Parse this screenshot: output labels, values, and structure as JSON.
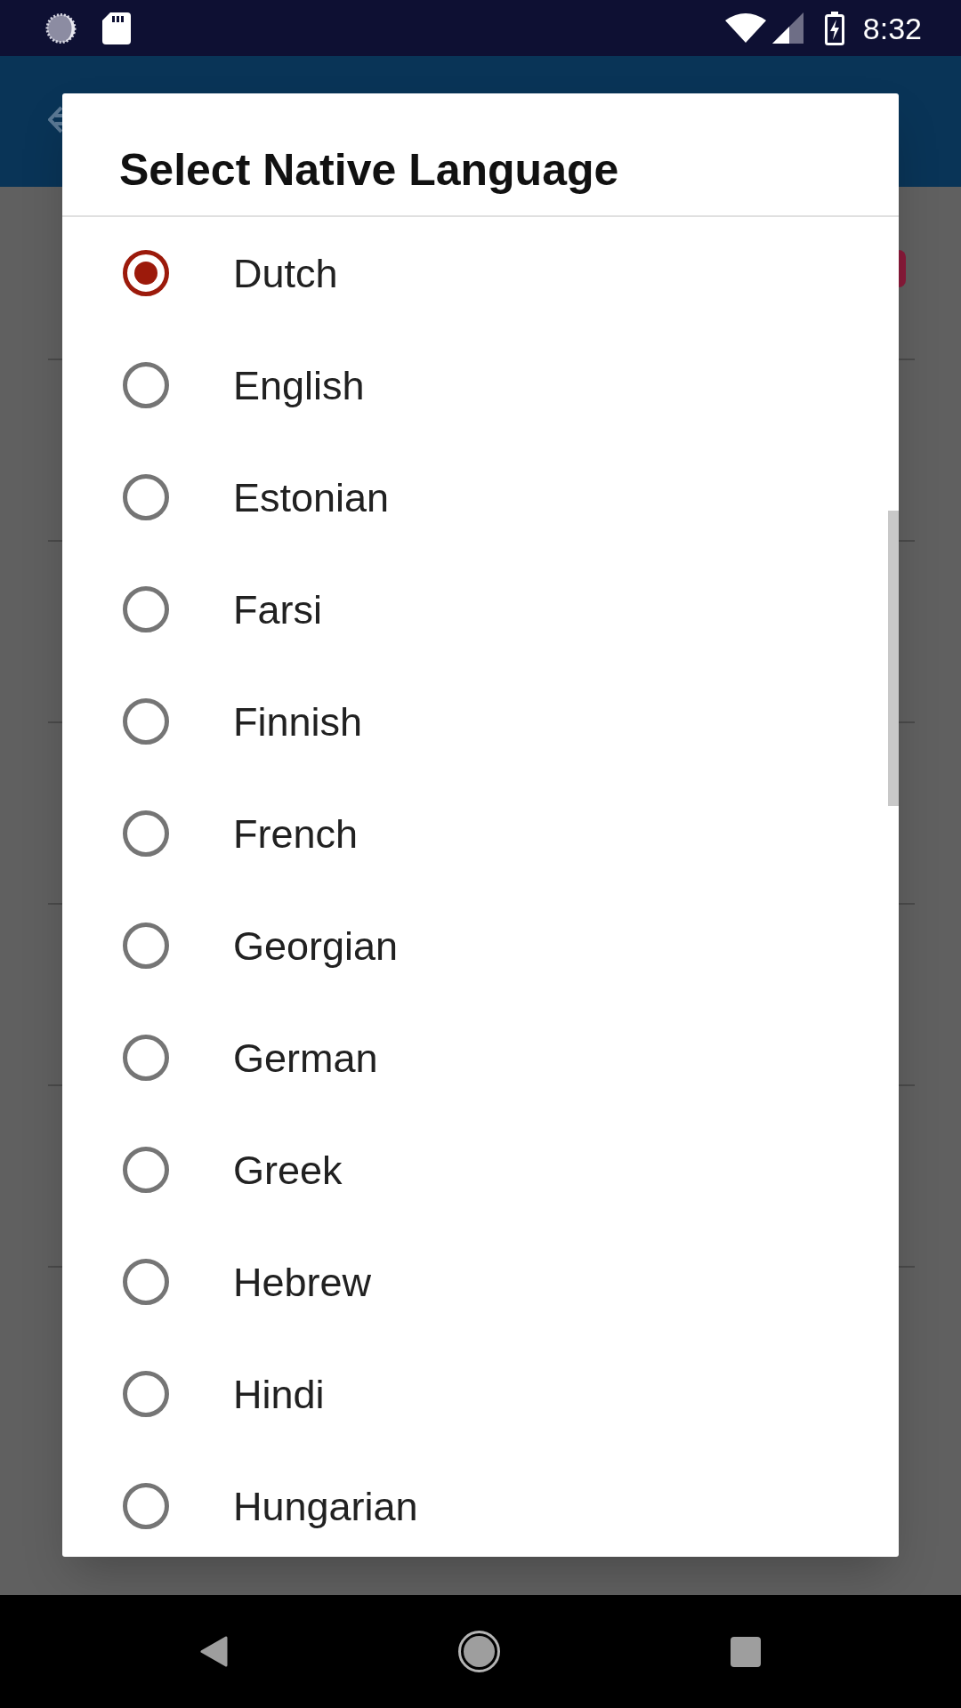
{
  "status_bar": {
    "time": "8:32"
  },
  "dialog": {
    "title": "Select Native Language",
    "options": [
      {
        "label": "Dutch",
        "selected": true
      },
      {
        "label": "English",
        "selected": false
      },
      {
        "label": "Estonian",
        "selected": false
      },
      {
        "label": "Farsi",
        "selected": false
      },
      {
        "label": "Finnish",
        "selected": false
      },
      {
        "label": "French",
        "selected": false
      },
      {
        "label": "Georgian",
        "selected": false
      },
      {
        "label": "German",
        "selected": false
      },
      {
        "label": "Greek",
        "selected": false
      },
      {
        "label": "Hebrew",
        "selected": false
      },
      {
        "label": "Hindi",
        "selected": false
      },
      {
        "label": "Hungarian",
        "selected": false
      }
    ]
  }
}
